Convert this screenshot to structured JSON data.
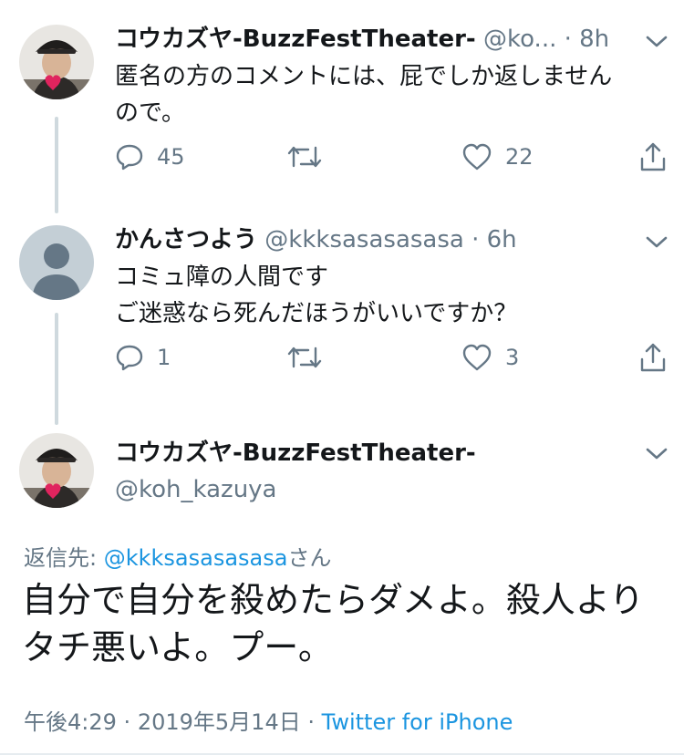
{
  "tweets": [
    {
      "name": "コウカズヤ-BuzzFestTheater-",
      "handle": "@ko...",
      "sep": "·",
      "time": "8h",
      "text_lines": [
        "匿名の方のコメントには、屁でしか返しません",
        "ので。"
      ],
      "replies": "45",
      "likes": "22"
    },
    {
      "name": "かんさつよう",
      "handle": "@kkksasasasasa",
      "sep": "·",
      "time": "6h",
      "text_lines": [
        "コミュ障の人間です",
        "ご迷惑なら死んだほうがいいですか？"
      ],
      "replies": "1",
      "likes": "3"
    }
  ],
  "main": {
    "name": "コウカズヤ-BuzzFestTheater-",
    "handle": "@koh_kazuya",
    "reply_prefix": "返信先: ",
    "reply_handle": "@kkksasasasasa",
    "reply_suffix": "さん",
    "text": "自分で自分を殺めたらダメよ。殺人よりタチ悪いよ。プー。",
    "time": "午後4:29",
    "sep1": "·",
    "date": "2019年5月14日",
    "sep2": "·",
    "client": "Twitter for iPhone"
  },
  "colors": {
    "text": "#14171a",
    "secondary": "#657786",
    "link": "#1b95e0",
    "line": "#cfd9de",
    "heart": "#e0245e"
  },
  "icons": [
    "reply-icon",
    "retweet-icon",
    "like-icon",
    "share-icon",
    "chevron-down-icon"
  ]
}
